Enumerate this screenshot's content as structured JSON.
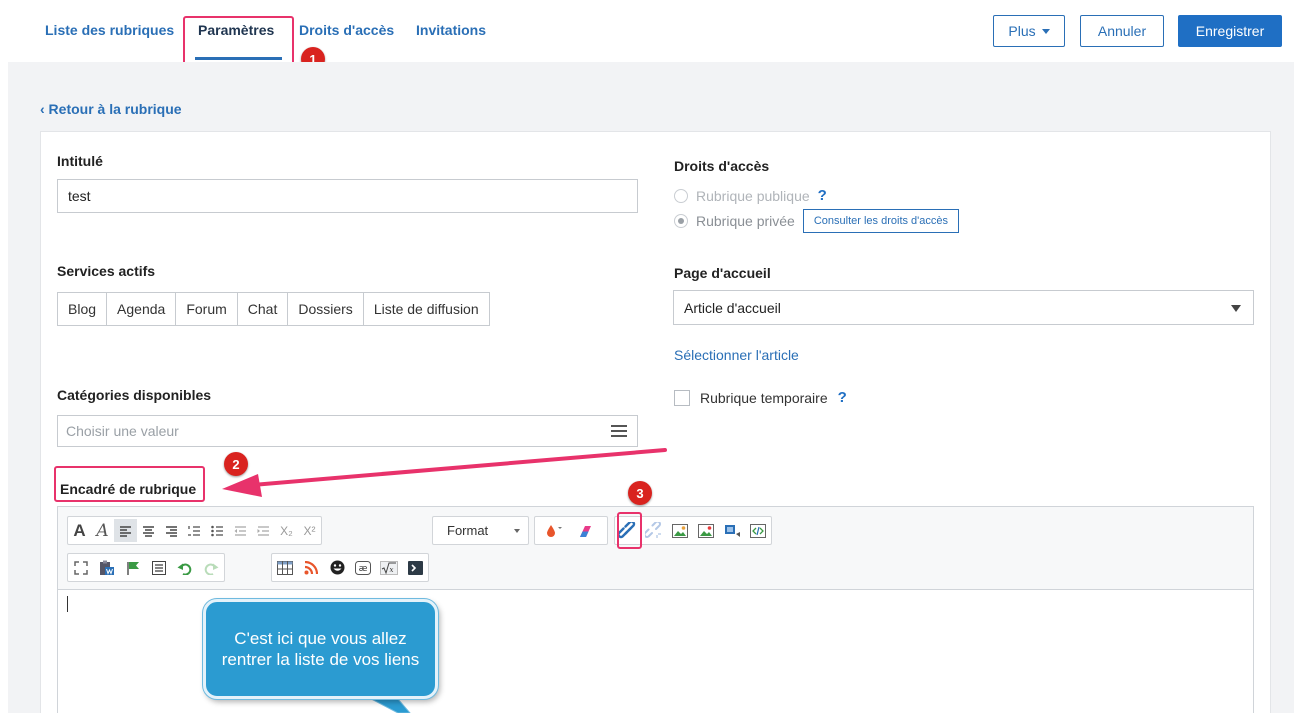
{
  "nav": {
    "tabs": [
      {
        "label": "Liste des rubriques"
      },
      {
        "label": "Paramètres"
      },
      {
        "label": "Droits d'accès"
      },
      {
        "label": "Invitations"
      }
    ],
    "more_label": "Plus",
    "cancel_label": "Annuler",
    "save_label": "Enregistrer"
  },
  "back_link": "‹ Retour à la rubrique",
  "form": {
    "title_label": "Intitulé",
    "title_value": "test",
    "services_label": "Services actifs",
    "services": [
      "Blog",
      "Agenda",
      "Forum",
      "Chat",
      "Dossiers",
      "Liste de diffusion"
    ],
    "categories_label": "Catégories disponibles",
    "categories_placeholder": "Choisir une valeur",
    "box_label": "Encadré de rubrique",
    "access_label": "Droits d'accès",
    "public_label": "Rubrique publique",
    "private_label": "Rubrique privée",
    "consult_label": "Consulter les droits d'accès",
    "homepage_label": "Page d'accueil",
    "homepage_value": "Article d'accueil",
    "select_article": "Sélectionner l'article",
    "temp_label": "Rubrique temporaire",
    "help_mark": "?"
  },
  "editor": {
    "format_label": "Format",
    "subscript": "X₂",
    "superscript": "X²"
  },
  "annotations": {
    "badges": [
      "1",
      "2",
      "3"
    ],
    "callout_text": "C'est ici que vous allez rentrer la liste de vos liens"
  },
  "colors": {
    "accent": "#2a6fb6",
    "primary_button": "#1f6fc4",
    "highlight": "#e8326b",
    "badge": "#d9231f",
    "callout": "#2b9bd1"
  }
}
